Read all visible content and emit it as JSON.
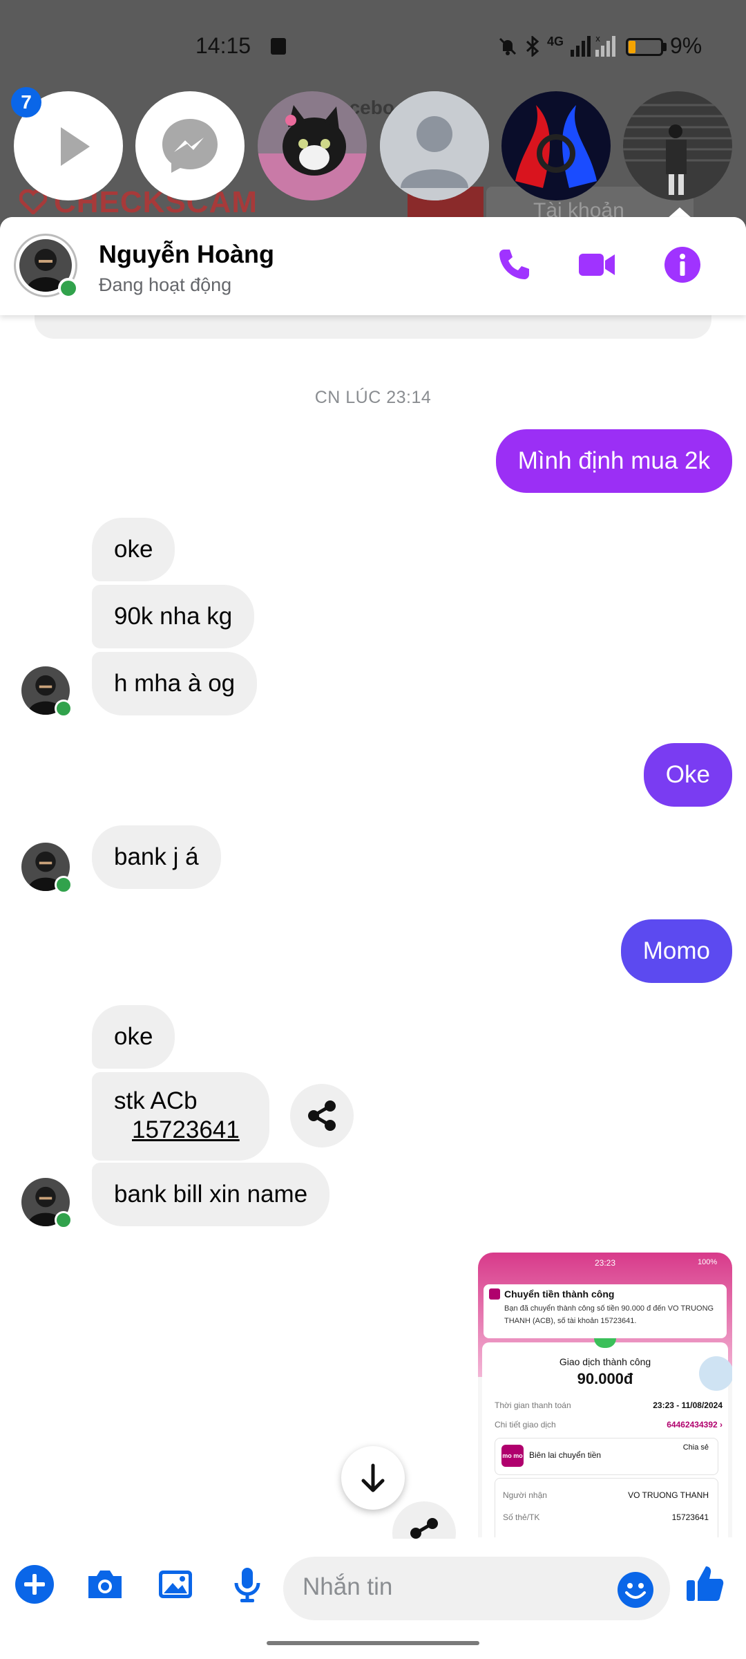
{
  "status_bar": {
    "time": "14:15",
    "battery": "9%",
    "network": "4G"
  },
  "background_page": {
    "logo_text": "CHECKSCAM",
    "account_button": "Tài khoản",
    "facebook_partial": "acebo"
  },
  "chat_heads": {
    "badge_count": "7",
    "items": [
      "video-play",
      "messenger",
      "cat-photo",
      "default-avatar",
      "red-blue-logo",
      "person-photo"
    ]
  },
  "header": {
    "contact_name": "Nguyễn Hoàng",
    "contact_status": "Đang hoạt động",
    "accent_color": "#a033ff"
  },
  "conversation": {
    "timestamp": "CN LÚC 23:14",
    "messages": {
      "out1": "Mình định mua 2k",
      "in1": "oke",
      "in2": "90k nha kg",
      "in3": "h mha à og",
      "out2": "Oke",
      "in4": "bank j á",
      "out3": "Momo",
      "in5": "oke",
      "in6_line1": "stk ACb",
      "in6_line2": "15723641",
      "in7": "bank bill xin name"
    },
    "out_colors": [
      "#9b2ff5",
      "#7a3cf2",
      "#5c4af0"
    ]
  },
  "receipt": {
    "status_time": "23:23",
    "status_batt": "100%",
    "notif_title": "Chuyển tiền thành công",
    "notif_body": "Bạn đã chuyển thành công số tiền 90.000 đ đến VO TRUONG THANH (ACB), số tài khoản 15723641.",
    "result_label": "Giao dịch thành công",
    "amount": "90.000đ",
    "row1_label": "Thời gian thanh toán",
    "row1_value": "23:23 - 11/08/2024",
    "row2_label": "Chi tiết giao dịch",
    "row2_value": "64462434392 ›",
    "receipt_title": "Biên lai chuyển tiền",
    "share": "Chia sẻ",
    "logo": "mo mo",
    "row3_label": "Người nhận",
    "row3_value": "VO TRUONG THANH",
    "row4_label": "Số thẻ/TK",
    "row4_value": "15723641"
  },
  "composer": {
    "placeholder": "Nhắn tin"
  },
  "icons": {
    "phone": "phone-icon",
    "video": "video-call-icon",
    "info": "info-icon",
    "plus": "plus-icon",
    "camera": "camera-icon",
    "gallery": "gallery-icon",
    "mic": "microphone-icon",
    "emoji": "emoji-icon",
    "like": "thumbs-up-icon",
    "share": "share-icon",
    "scroll": "arrow-down-icon"
  }
}
